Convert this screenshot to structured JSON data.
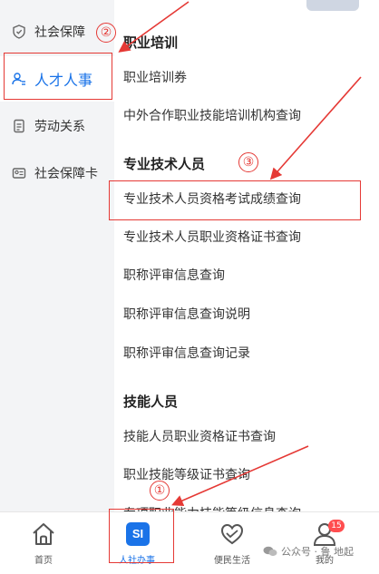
{
  "sidebar": {
    "items": [
      {
        "label": "社会保障",
        "icon": "shield-check-icon"
      },
      {
        "label": "人才人事",
        "icon": "user-list-icon",
        "active": true
      },
      {
        "label": "劳动关系",
        "icon": "document-icon"
      },
      {
        "label": "社会保障卡",
        "icon": "id-card-icon"
      }
    ]
  },
  "sections": [
    {
      "title": "职业培训",
      "items": [
        "职业培训券",
        "中外合作职业技能培训机构查询"
      ]
    },
    {
      "title": "专业技术人员",
      "items": [
        "专业技术人员资格考试成绩查询",
        "专业技术人员职业资格证书查询",
        "职称评审信息查询",
        "职称评审信息查询说明",
        "职称评审信息查询记录"
      ]
    },
    {
      "title": "技能人员",
      "items": [
        "技能人员职业资格证书查询",
        "职业技能等级证书查询",
        "专项职业能力技能等级信息查询"
      ]
    }
  ],
  "tabbar": {
    "items": [
      {
        "label": "首页",
        "icon": "home-icon"
      },
      {
        "label": "人社办事",
        "icon": "si-icon",
        "icon_text": "SI",
        "active": true
      },
      {
        "label": "便民生活",
        "icon": "heart-hands-icon"
      },
      {
        "label": "我的",
        "icon": "user-icon",
        "badge": "15"
      }
    ]
  },
  "watermark": {
    "text": "公众号 · 鲁 地起"
  },
  "annotations": {
    "one": "①",
    "two": "②",
    "three": "③"
  },
  "colors": {
    "accent": "#1a73e8",
    "annotation": "#e53935",
    "sidebar_bg": "#f3f4f6",
    "badge": "#ff4d4f"
  }
}
